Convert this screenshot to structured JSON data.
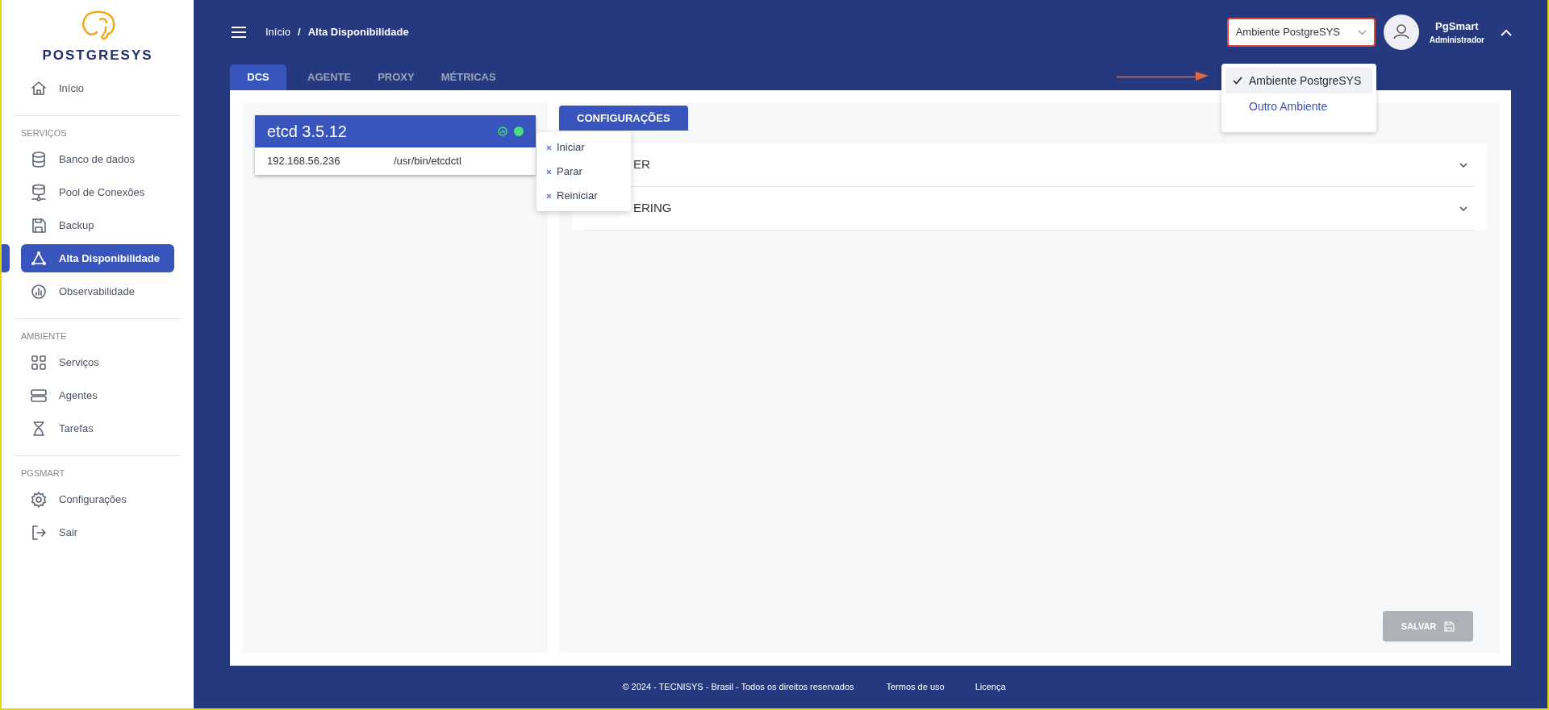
{
  "logo": {
    "text": "POSTGRESYS"
  },
  "sidebar": {
    "sections": [
      {
        "items": [
          {
            "label": "Início",
            "selected": false
          }
        ]
      },
      {
        "heading": "SERVIÇOS",
        "items": [
          {
            "label": "Banco de dados",
            "selected": false
          },
          {
            "label": "Pool de Conexões",
            "selected": false
          },
          {
            "label": "Backup",
            "selected": false
          },
          {
            "label": "Alta Disponibilidade",
            "selected": true
          },
          {
            "label": "Observabilidade",
            "selected": false
          }
        ]
      },
      {
        "heading": "AMBIENTE",
        "items": [
          {
            "label": "Serviços",
            "selected": false
          },
          {
            "label": "Agentes",
            "selected": false
          },
          {
            "label": "Tarefas",
            "selected": false
          }
        ]
      },
      {
        "heading": "PGSMART",
        "items": [
          {
            "label": "Configurações",
            "selected": false
          },
          {
            "label": "Sair",
            "selected": false
          }
        ]
      }
    ]
  },
  "breadcrumb": {
    "items": [
      "Início",
      "Alta Disponibilidade"
    ],
    "separator": "/"
  },
  "environment_select": {
    "value": "Ambiente PostgreSYS",
    "expanded": true,
    "options": [
      {
        "label": "Ambiente PostgreSYS",
        "selected": true
      },
      {
        "label": "Outro Ambiente",
        "selected": false
      }
    ]
  },
  "user": {
    "name": "PgSmart",
    "role": "Administrador"
  },
  "tabs": [
    {
      "label": "DCS",
      "selected": true
    },
    {
      "label": "AGENTE",
      "selected": false
    },
    {
      "label": "PROXY",
      "selected": false
    },
    {
      "label": "MÉTRICAS",
      "selected": false
    }
  ],
  "dcs_card": {
    "title": "etcd 3.5.12",
    "address": "192.168.56.236",
    "path": "/usr/bin/etcdctl"
  },
  "context_menu": [
    "Iniciar",
    "Parar",
    "Reiniciar"
  ],
  "config_tabs": [
    {
      "label": "CONFIGURAÇÕES",
      "selected": true
    }
  ],
  "accordion": [
    {
      "label": "ER",
      "expanded": false
    },
    {
      "label": "ERING",
      "expanded": false
    }
  ],
  "save_button": {
    "label": "SALVAR",
    "disabled": true
  },
  "footer": {
    "copyright": "© 2024 - TECNISYS - Brasil - Todos os direitos reservados",
    "links": [
      "Termos de uso",
      "Licença"
    ]
  }
}
